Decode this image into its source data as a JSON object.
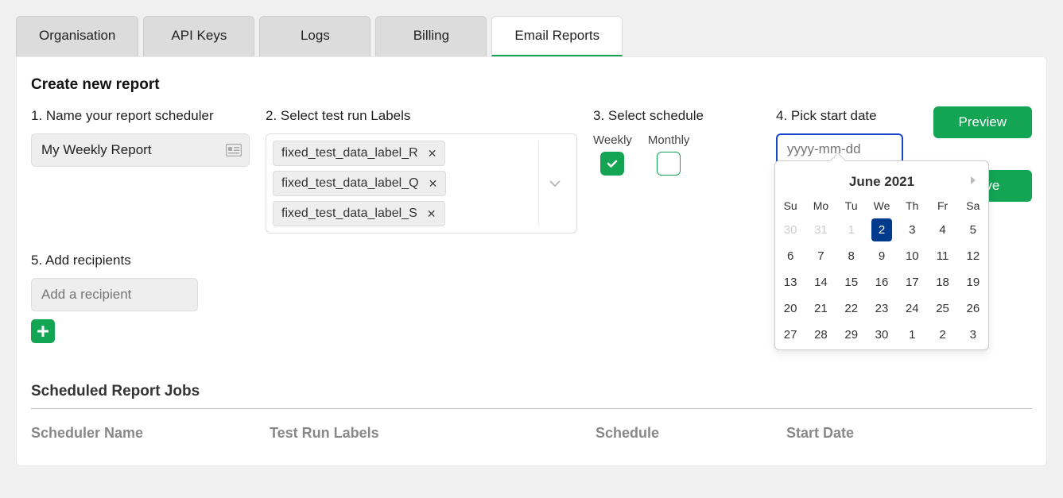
{
  "tabs": [
    {
      "label": "Organisation"
    },
    {
      "label": "API Keys"
    },
    {
      "label": "Logs"
    },
    {
      "label": "Billing"
    },
    {
      "label": "Email Reports"
    }
  ],
  "section_title": "Create new report",
  "step1": {
    "label": "1. Name your report scheduler",
    "value": "My Weekly Report"
  },
  "step2": {
    "label": "2. Select test run Labels",
    "tags": [
      "fixed_test_data_label_R",
      "fixed_test_data_label_Q",
      "fixed_test_data_label_S"
    ]
  },
  "step3": {
    "label": "3. Select schedule",
    "options": [
      {
        "label": "Weekly",
        "checked": true
      },
      {
        "label": "Monthly",
        "checked": false
      }
    ]
  },
  "step4": {
    "label": "4. Pick start date",
    "placeholder": "yyyy-mm-dd"
  },
  "step5": {
    "label": "5. Add recipients",
    "placeholder": "Add a recipient"
  },
  "buttons": {
    "preview": "Preview",
    "save": "Save"
  },
  "calendar": {
    "title": "June 2021",
    "dow": [
      "Su",
      "Mo",
      "Tu",
      "We",
      "Th",
      "Fr",
      "Sa"
    ],
    "weeks": [
      [
        {
          "d": "30",
          "muted": true
        },
        {
          "d": "31",
          "muted": true
        },
        {
          "d": "1",
          "muted": true
        },
        {
          "d": "2",
          "selected": true
        },
        {
          "d": "3"
        },
        {
          "d": "4"
        },
        {
          "d": "5"
        }
      ],
      [
        {
          "d": "6"
        },
        {
          "d": "7"
        },
        {
          "d": "8"
        },
        {
          "d": "9"
        },
        {
          "d": "10"
        },
        {
          "d": "11"
        },
        {
          "d": "12"
        }
      ],
      [
        {
          "d": "13"
        },
        {
          "d": "14"
        },
        {
          "d": "15"
        },
        {
          "d": "16"
        },
        {
          "d": "17"
        },
        {
          "d": "18"
        },
        {
          "d": "19"
        }
      ],
      [
        {
          "d": "20"
        },
        {
          "d": "21"
        },
        {
          "d": "22"
        },
        {
          "d": "23"
        },
        {
          "d": "24"
        },
        {
          "d": "25"
        },
        {
          "d": "26"
        }
      ],
      [
        {
          "d": "27"
        },
        {
          "d": "28"
        },
        {
          "d": "29"
        },
        {
          "d": "30"
        },
        {
          "d": "1"
        },
        {
          "d": "2"
        },
        {
          "d": "3"
        }
      ]
    ]
  },
  "jobs": {
    "title": "Scheduled Report Jobs",
    "columns": [
      "Scheduler Name",
      "Test Run Labels",
      "Schedule",
      "Start Date"
    ]
  }
}
